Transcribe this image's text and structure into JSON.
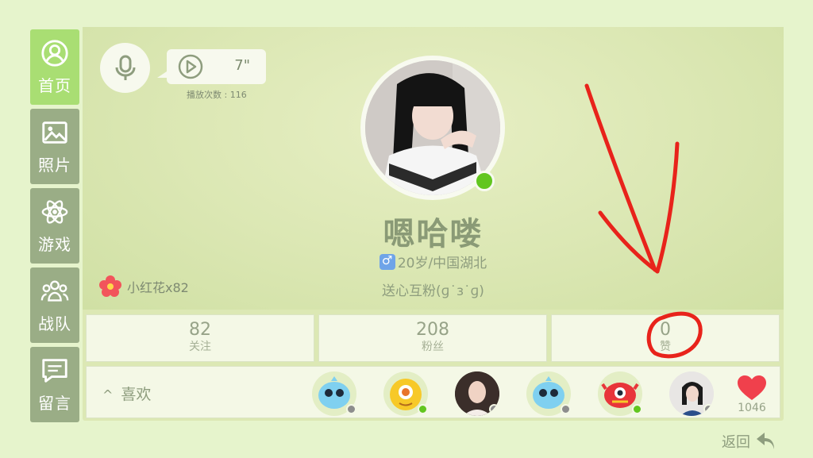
{
  "sidebar": {
    "items": [
      {
        "label": "首页",
        "icon": "user-icon",
        "active": true
      },
      {
        "label": "照片",
        "icon": "photo-icon",
        "active": false
      },
      {
        "label": "游戏",
        "icon": "atom-icon",
        "active": false
      },
      {
        "label": "战队",
        "icon": "team-icon",
        "active": false
      },
      {
        "label": "留言",
        "icon": "message-icon",
        "active": false
      }
    ]
  },
  "voice": {
    "duration": "7\"",
    "play_count": "播放次数 : 116"
  },
  "profile": {
    "nickname": "嗯哈喽",
    "age_location": "20岁/中国湖北",
    "signature": "送心互粉(ɡ˙ɜ˙ɡ)",
    "flower_badge": "小红花x82",
    "online": true
  },
  "stats": [
    {
      "value": "82",
      "label": "关注"
    },
    {
      "value": "208",
      "label": "粉丝"
    },
    {
      "value": "0",
      "label": "赞"
    }
  ],
  "likes": {
    "label": "喜欢",
    "users": [
      {
        "type": "blue-monster",
        "status": "offline"
      },
      {
        "type": "yellow-monster",
        "status": "online"
      },
      {
        "type": "photo",
        "status": "offline"
      },
      {
        "type": "blue-monster",
        "status": "offline"
      },
      {
        "type": "red-monster",
        "status": "online"
      },
      {
        "type": "photo",
        "status": "offline"
      }
    ],
    "heart_count": "1046"
  },
  "footer": {
    "back_label": "返回"
  },
  "colors": {
    "accent_green": "#a9de73",
    "online": "#62c61f",
    "offline": "#8d8d8d",
    "annotation": "#e8231b"
  }
}
